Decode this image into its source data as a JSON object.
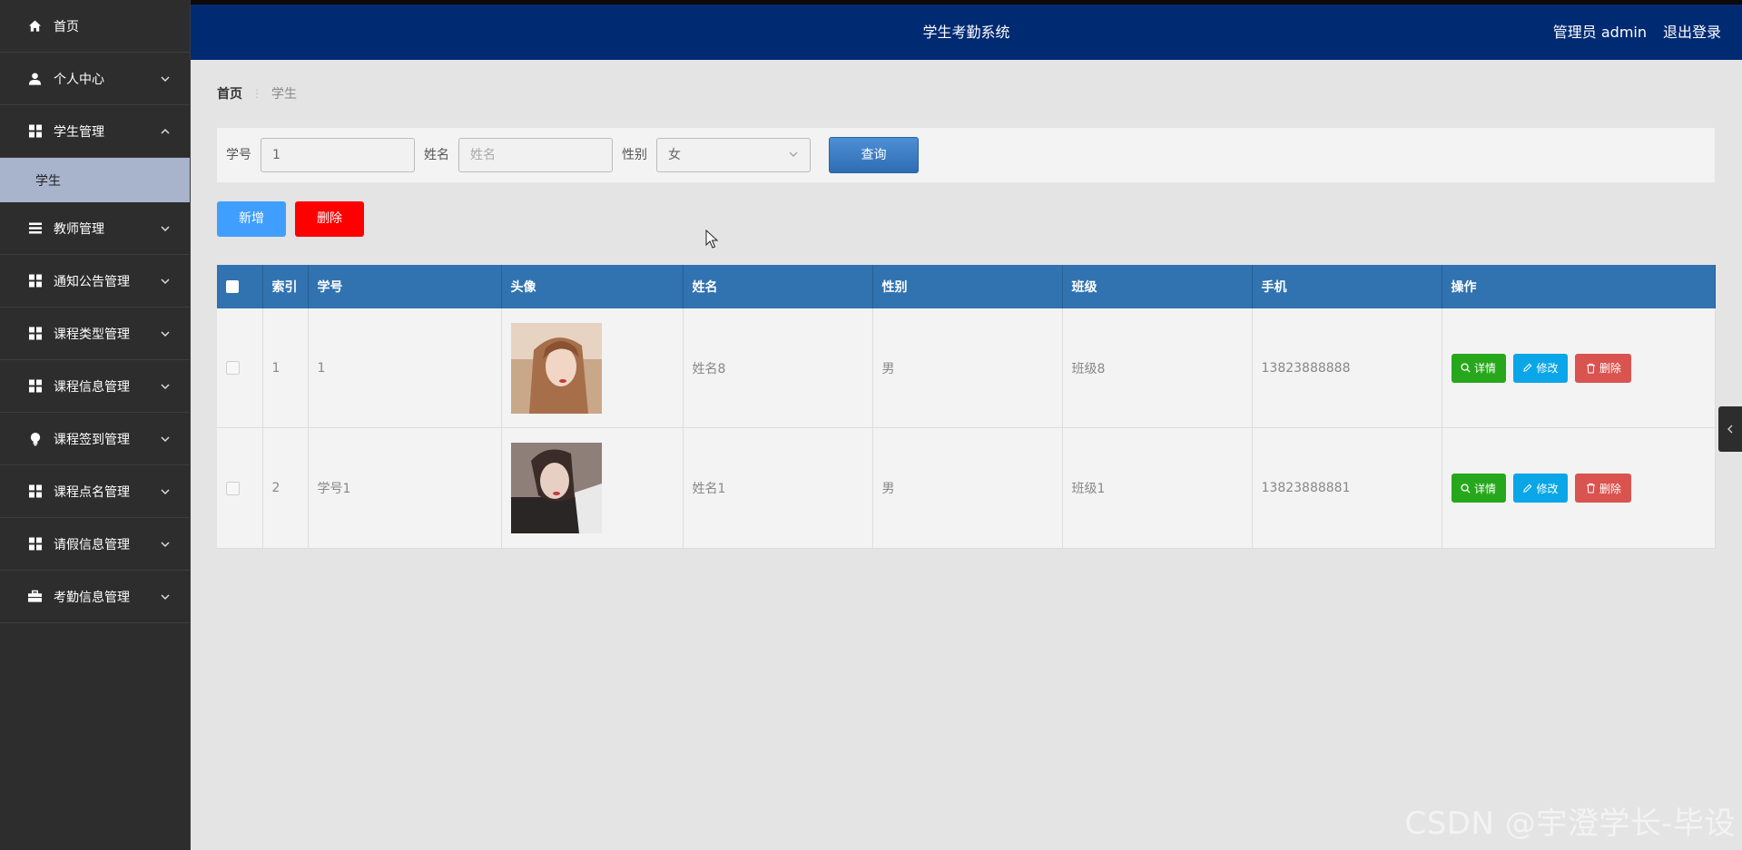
{
  "sidebar": {
    "items": [
      {
        "label": "首页",
        "icon": "home-icon",
        "expandable": false
      },
      {
        "label": "个人中心",
        "icon": "user-icon",
        "expandable": true
      },
      {
        "label": "学生管理",
        "icon": "grid-icon",
        "expandable": true,
        "expanded": true,
        "children": [
          {
            "label": "学生"
          }
        ]
      },
      {
        "label": "教师管理",
        "icon": "list-icon",
        "expandable": true
      },
      {
        "label": "通知公告管理",
        "icon": "grid-icon",
        "expandable": true
      },
      {
        "label": "课程类型管理",
        "icon": "grid-icon",
        "expandable": true
      },
      {
        "label": "课程信息管理",
        "icon": "grid-icon",
        "expandable": true
      },
      {
        "label": "课程签到管理",
        "icon": "bulb-icon",
        "expandable": true
      },
      {
        "label": "课程点名管理",
        "icon": "grid-icon",
        "expandable": true
      },
      {
        "label": "请假信息管理",
        "icon": "grid-icon",
        "expandable": true
      },
      {
        "label": "考勤信息管理",
        "icon": "briefcase-icon",
        "expandable": true
      }
    ]
  },
  "header": {
    "title": "学生考勤系统",
    "user": "管理员 admin",
    "logout": "退出登录"
  },
  "breadcrumb": {
    "home": "首页",
    "current": "学生"
  },
  "search": {
    "student_no_label": "学号",
    "student_no_value": "1",
    "name_label": "姓名",
    "name_placeholder": "姓名",
    "gender_label": "性别",
    "gender_value": "女",
    "query_button": "查询"
  },
  "actions": {
    "add": "新增",
    "delete": "删除"
  },
  "table": {
    "columns": [
      "索引",
      "学号",
      "头像",
      "姓名",
      "性别",
      "班级",
      "手机",
      "操作"
    ],
    "rows": [
      {
        "index": "1",
        "student_no": "1",
        "name": "姓名8",
        "gender": "男",
        "class": "班级8",
        "phone": "13823888888"
      },
      {
        "index": "2",
        "student_no": "学号1",
        "name": "姓名1",
        "gender": "男",
        "class": "班级1",
        "phone": "13823888881"
      }
    ],
    "row_actions": {
      "detail": "详情",
      "edit": "修改",
      "delete": "删除"
    }
  },
  "watermark": "CSDN @宇澄学长-毕设",
  "colors": {
    "sidebar_bg": "#2d2d2d",
    "header_bg": "#002a72",
    "table_header": "#3172b0",
    "detail_btn": "#27a71b",
    "edit_btn": "#0ba6e8",
    "delete_btn": "#d9534f",
    "add_btn": "#409eff",
    "bulk_delete_btn": "#ff0000"
  }
}
